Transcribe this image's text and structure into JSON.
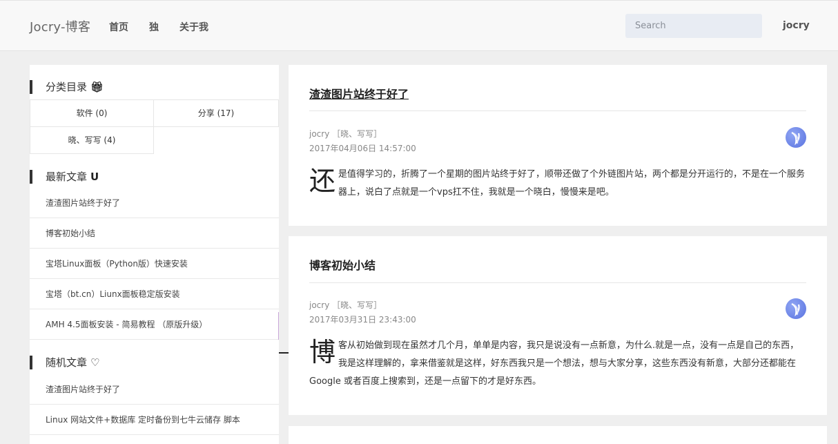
{
  "header": {
    "brand": "Jocry-博客",
    "nav": [
      "首页",
      "独",
      "关于我"
    ],
    "search_placeholder": "Search",
    "user": "jocry"
  },
  "sidebar": {
    "categories_title": "分类目录",
    "categories_icon": "gift-icon",
    "categories": [
      "软件 (0)",
      "分享 (17)",
      "晓、写写 (4)"
    ],
    "latest_title": "最新文章",
    "latest_icon": "magnet-icon",
    "latest": [
      "渣渣图片站终于好了",
      "博客初始小结",
      "宝塔Linux面板（Python版）快速安装",
      "宝塔（bt.cn）Liunx面板稳定版安装",
      "AMH 4.5面板安装 - 简易教程 （原版升级）"
    ],
    "random_title": "随机文章",
    "random_icon": "heart-icon",
    "random": [
      "渣渣图片站终于好了",
      "Linux 网站文件+数据库 定时备份到七牛云储存 脚本"
    ]
  },
  "posts": [
    {
      "title": "渣渣图片站终于好了",
      "author_cat": "jocry ［晓、写写］",
      "date": "2017年04月06日 14:57:00",
      "dropcap": "还",
      "excerpt": "是值得学习的，折腾了一个星期的图片站终于好了，顺带还做了个外链图片站，两个都是分开运行的，不是在一个服务器上，说白了点就是一个vps扛不住，我就是一个晓白，慢慢来是吧。"
    },
    {
      "title": "博客初始小结",
      "author_cat": "jocry ［晓、写写］",
      "date": "2017年03月31日 23:43:00",
      "dropcap": "博",
      "excerpt": "客从初始做到现在虽然才几个月，单单是内容，我只是说没有一点新意，为什么.就是一点，没有一点是自己的东西，我是这样理解的，拿来借鉴就是这样，好东西我只是一个想法，想与大家分享，这些东西没有新意，大部分还都能在 Google 或者百度上搜索到，还是一点留下的才是好东西。"
    }
  ]
}
